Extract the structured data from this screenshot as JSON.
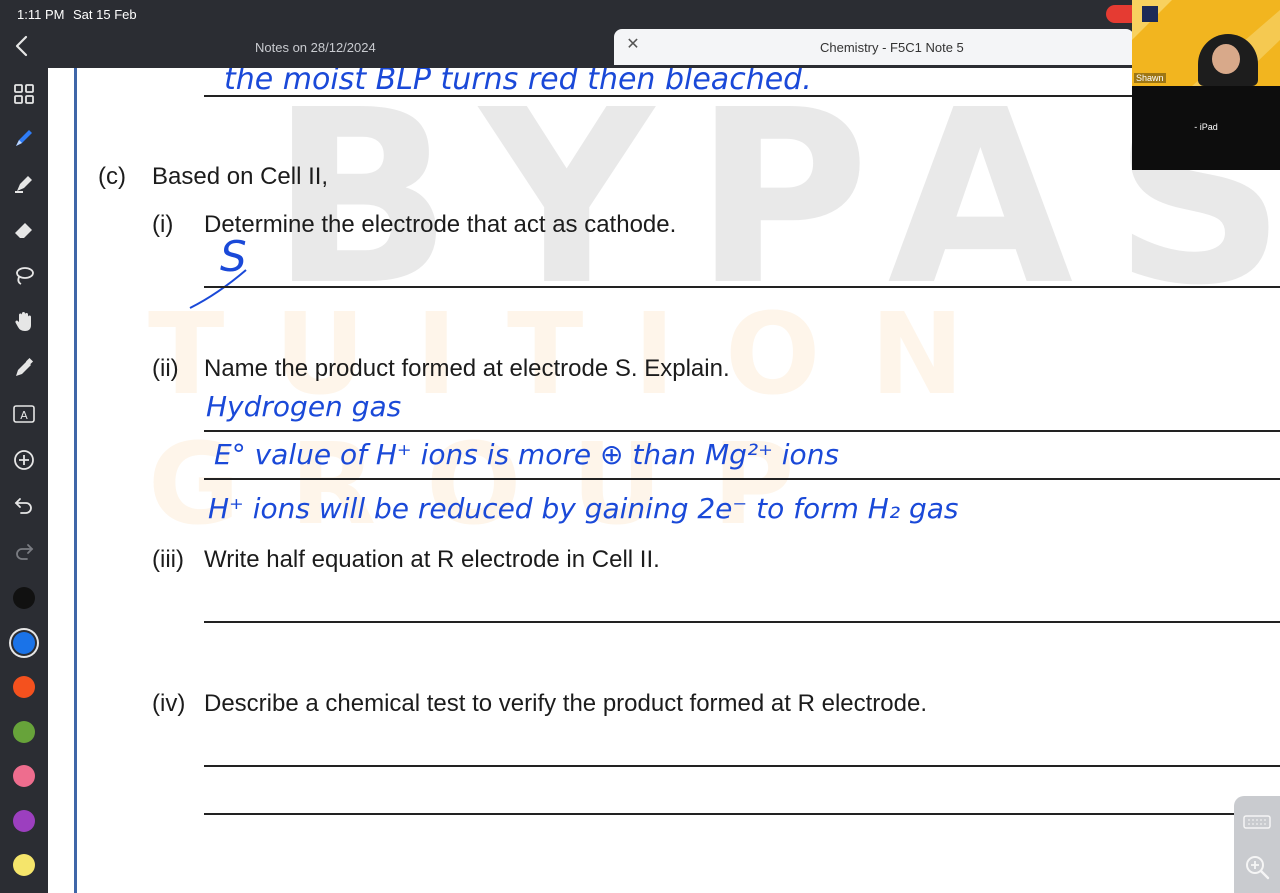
{
  "status_bar": {
    "time": "1:11 PM",
    "date": "Sat 15 Feb"
  },
  "tabs": {
    "left": "Notes on 28/12/2024",
    "active": "Chemistry - F5C1 Note 5"
  },
  "video": {
    "presenter": "Shawn",
    "device": "- iPad"
  },
  "toolbar": {
    "tools": [
      "back-icon",
      "grid-icon",
      "pen-icon",
      "highlighter-icon",
      "eraser-icon",
      "lasso-icon",
      "hand-icon",
      "marker-icon",
      "text-box-icon",
      "add-icon",
      "undo-icon",
      "redo-icon"
    ],
    "colors": [
      "#111111",
      "#1a73e8",
      "#f4511e",
      "#67a33a",
      "#ee6d8e",
      "#9c3fbf",
      "#f5e56b"
    ],
    "selected_color": "#1a73e8"
  },
  "watermark": {
    "line1": "BYPASS",
    "line2": "TUITION GROUP"
  },
  "worksheet": {
    "c": {
      "num": "(c)",
      "text": "Based on Cell II,"
    },
    "c_i": {
      "num": "(i)",
      "text": "Determine the electrode that act as cathode."
    },
    "c_ii": {
      "num": "(ii)",
      "text": "Name the product formed at electrode S. Explain."
    },
    "c_iii": {
      "num": "(iii)",
      "text": "Write half equation at R electrode in Cell II."
    },
    "c_iv": {
      "num": "(iv)",
      "text": "Describe a chemical test to verify the product formed at R electrode."
    }
  },
  "handwriting": {
    "top": "the moist BLP turns red then bleached.",
    "answer_i": "S",
    "answer_ii_1": "Hydrogen gas",
    "answer_ii_2": "E° value of H⁺ ions is more ⊕ than Mg²⁺ ions",
    "answer_ii_3": "H⁺ ions will be reduced by gaining 2e⁻ to form H₂ gas"
  }
}
